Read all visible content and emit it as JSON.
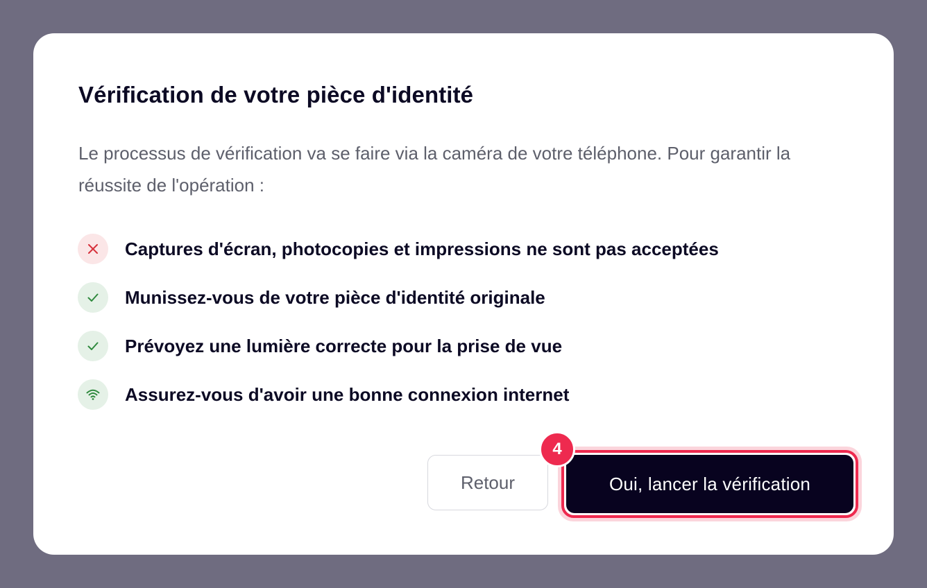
{
  "dialog": {
    "title": "Vérification de votre pièce d'identité",
    "intro": "Le processus de vérification va se faire via la caméra de votre téléphone. Pour garantir la réussite de l'opération :",
    "checklist": [
      {
        "icon": "close-icon",
        "status": "danger",
        "label": "Captures d'écran, photocopies et impressions ne sont pas acceptées"
      },
      {
        "icon": "check-icon",
        "status": "ok",
        "label": "Munissez-vous de votre pièce d'identité originale"
      },
      {
        "icon": "check-icon",
        "status": "ok",
        "label": "Prévoyez une lumière correcte pour la prise de vue"
      },
      {
        "icon": "wifi-icon",
        "status": "ok",
        "label": "Assurez-vous d'avoir une bonne connexion internet"
      }
    ],
    "back_label": "Retour",
    "confirm_label": "Oui, lancer la vérification",
    "step_number": "4"
  },
  "colors": {
    "overlay": "#6f6c80",
    "dialog_bg": "#ffffff",
    "text_primary": "#0c0a24",
    "text_secondary": "#5d5f6b",
    "danger": "#d6323c",
    "danger_bg": "#fbe6e7",
    "success": "#2f8a3e",
    "success_bg": "#e5f1e7",
    "primary_button": "#08031f",
    "highlight": "#ee2a4f"
  }
}
